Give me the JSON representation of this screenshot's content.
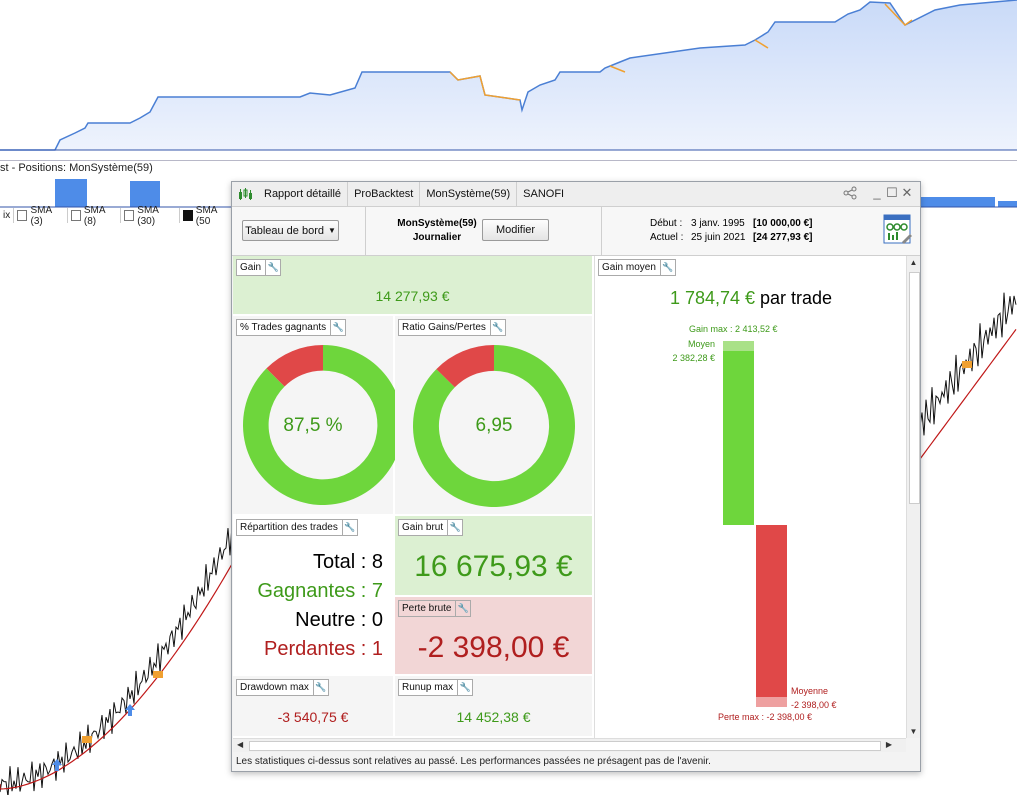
{
  "background": {
    "positions_label": "st - Positions: MonSystème(59)",
    "indicators": [
      {
        "label": "ix",
        "checked": false,
        "has_box": false
      },
      {
        "label": "SMA (3)",
        "checked": false,
        "has_box": true
      },
      {
        "label": "SMA (8)",
        "checked": false,
        "has_box": true
      },
      {
        "label": "SMA (30)",
        "checked": false,
        "has_box": true
      },
      {
        "label": "SMA (50",
        "checked": true,
        "has_box": true
      }
    ]
  },
  "window": {
    "tabs": [
      "Rapport détaillé",
      "ProBacktest",
      "MonSystème(59)",
      "SANOFI"
    ],
    "dashboard_dropdown": "Tableau de bord",
    "system_name": "MonSystème(59)",
    "timeframe": "Journalier",
    "modify_button": "Modifier",
    "start_label": "Début :",
    "start_date": "3 janv. 1995",
    "start_capital": "[10 000,00 €]",
    "current_label": "Actuel :",
    "current_date": "25 juin 2021",
    "current_capital": "[24 277,93 €]",
    "footer": "Les statistiques ci-dessus sont relatives au passé. Les performances passées ne présagent pas de l'avenir."
  },
  "panels": {
    "gain": {
      "label": "Gain",
      "value": "14 277,93 €"
    },
    "pct_winning": {
      "label": "% Trades gagnants",
      "value": "87,5 %",
      "fraction": 0.875
    },
    "ratio": {
      "label": "Ratio Gains/Pertes",
      "value": "6,95",
      "fraction": 0.874
    },
    "repartition": {
      "label": "Répartition des trades",
      "total": "Total : 8",
      "winners": "Gagnantes : 7",
      "neutral": "Neutre : 0",
      "losers": "Perdantes : 1"
    },
    "gross_gain": {
      "label": "Gain brut",
      "value": "16 675,93 €"
    },
    "gross_loss": {
      "label": "Perte brute",
      "value": "-2 398,00 €"
    },
    "drawdown": {
      "label": "Drawdown max",
      "value": "-3 540,75 €"
    },
    "runup": {
      "label": "Runup max",
      "value": "14 452,38 €"
    },
    "avg_gain": {
      "label": "Gain moyen",
      "amount": "1 784,74 €",
      "suffix": " par trade",
      "gain_max_label": "Gain max : 2 413,52 €",
      "avg_win_label": "Moyen",
      "avg_win_value": "2 382,28 €",
      "avg_loss_label": "Moyenne",
      "avg_loss_value": "-2 398,00 €",
      "loss_max_label": "Perte max : -2 398,00 €"
    }
  },
  "colors": {
    "green": "#6ed63c",
    "red": "#e04848",
    "green_text": "#3e9a1a",
    "red_text": "#b01f1f",
    "equity_blue": "#4a7fd4",
    "equity_orange": "#f0a030"
  }
}
